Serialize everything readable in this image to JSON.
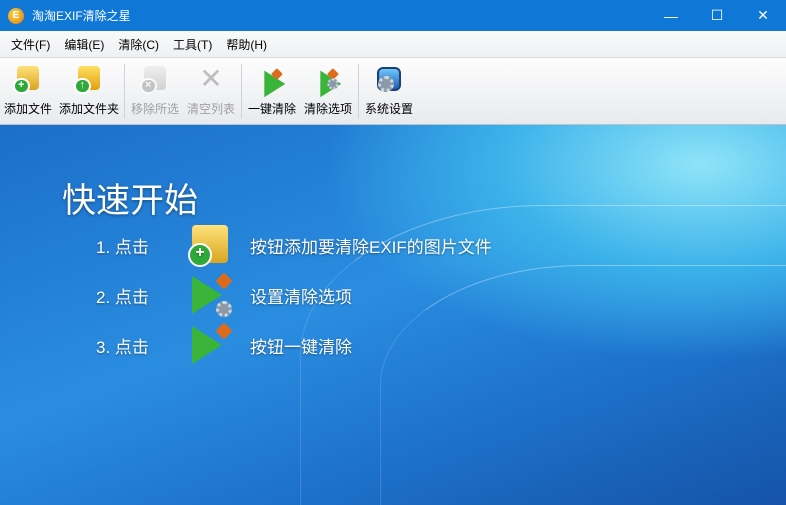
{
  "window": {
    "title": "淘淘EXIF清除之星",
    "minimize": "—",
    "maximize": "☐",
    "close": "✕"
  },
  "menu": [
    "文件(F)",
    "编辑(E)",
    "清除(C)",
    "工具(T)",
    "帮助(H)"
  ],
  "toolbar": {
    "add_file": "添加文件",
    "add_folder": "添加文件夹",
    "remove_selected": "移除所选",
    "clear_list": "清空列表",
    "one_click_clean": "一键清除",
    "clean_options": "清除选项",
    "settings": "系统设置"
  },
  "quickstart": {
    "title": "快速开始",
    "steps": [
      {
        "num": "1. 点击",
        "text": "按钮添加要清除EXIF的图片文件"
      },
      {
        "num": "2. 点击",
        "text": "设置清除选项"
      },
      {
        "num": "3. 点击",
        "text": "按钮一键清除"
      }
    ]
  }
}
